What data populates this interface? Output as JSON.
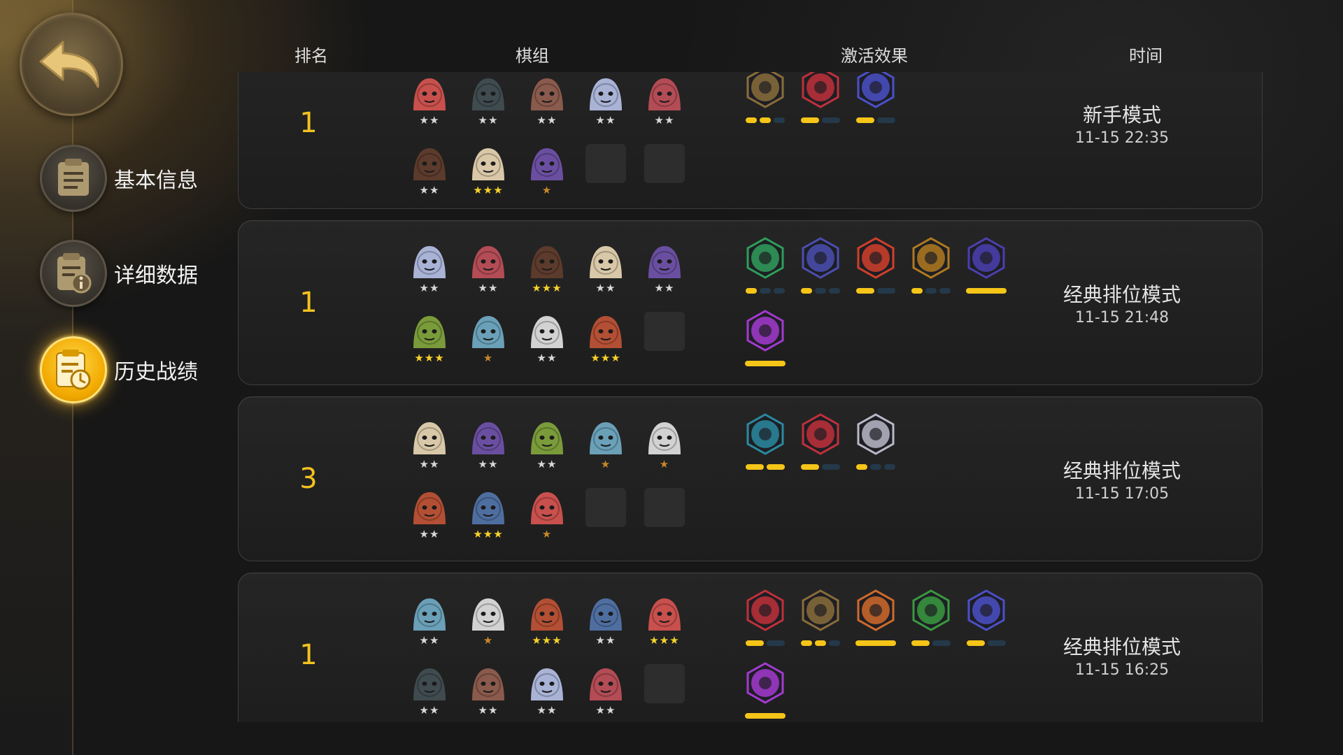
{
  "header": {
    "rank": "排名",
    "lineup": "棋组",
    "effects": "激活效果",
    "time": "时间"
  },
  "sidebar": {
    "back_icon": "back-arrow-icon",
    "items": [
      {
        "label": "基本信息",
        "icon": "notepad-icon",
        "active": false
      },
      {
        "label": "详细数据",
        "icon": "info-document-icon",
        "active": false
      },
      {
        "label": "历史战绩",
        "icon": "history-clock-icon",
        "active": true
      }
    ]
  },
  "colors": {
    "accent_gold": "#f4c21f",
    "active_nav": "#f2a900",
    "bar_on": "#f5c518",
    "bar_off": "#24394a"
  },
  "matches": [
    {
      "rank": "1",
      "mode": "新手模式",
      "time": "11-15 22:35",
      "heroes": [
        {
          "icon": "red-demon-hero",
          "stars": "★★"
        },
        {
          "icon": "green-eye-robot-hero",
          "stars": "★★"
        },
        {
          "icon": "masked-assassin-hero",
          "stars": "★★"
        },
        {
          "icon": "blue-ghost-hero",
          "stars": "★★"
        },
        {
          "icon": "red-hood-hero",
          "stars": "★★"
        },
        {
          "icon": "bearded-warrior-hero",
          "stars": "★★"
        },
        {
          "icon": "white-ogre-hero",
          "stars": "★★★"
        },
        {
          "icon": "purple-skull-hero",
          "stars": "★"
        },
        {
          "icon": "empty-slot",
          "stars": ""
        },
        {
          "icon": "empty-slot",
          "stars": ""
        }
      ],
      "synergies": [
        {
          "icon": "axe-emblem-icon",
          "on": 2,
          "total": 3
        },
        {
          "icon": "red-arch-emblem-icon",
          "on": 1,
          "total": 2
        },
        {
          "icon": "blue-fish-emblem-icon",
          "on": 1,
          "total": 2
        }
      ]
    },
    {
      "rank": "1",
      "mode": "经典排位模式",
      "time": "11-15 21:48",
      "heroes": [
        {
          "icon": "horned-brute-hero",
          "stars": "★★"
        },
        {
          "icon": "green-lizard-hero",
          "stars": "★★"
        },
        {
          "icon": "orc-helmet-hero",
          "stars": "★★★"
        },
        {
          "icon": "green-robot-hero",
          "stars": "★★"
        },
        {
          "icon": "stone-golem-hero",
          "stars": "★★"
        },
        {
          "icon": "green-bandit-hero",
          "stars": "★★★"
        },
        {
          "icon": "feather-chief-hero",
          "stars": "★"
        },
        {
          "icon": "fox-mask-hero",
          "stars": "★★"
        },
        {
          "icon": "goblin-hero",
          "stars": "★★★"
        },
        {
          "icon": "empty-slot",
          "stars": ""
        }
      ],
      "synergies": [
        {
          "icon": "green-paw-emblem-icon",
          "on": 1,
          "total": 3
        },
        {
          "icon": "blue-book-emblem-icon",
          "on": 1,
          "total": 3
        },
        {
          "icon": "red-horn-emblem-icon",
          "on": 1,
          "total": 2
        },
        {
          "icon": "gear-emblem-icon",
          "on": 1,
          "total": 3
        },
        {
          "icon": "wizard-hat-emblem-icon",
          "on": 1,
          "total": 1
        },
        {
          "icon": "purple-demon-emblem-icon",
          "on": 1,
          "total": 1
        }
      ]
    },
    {
      "rank": "3",
      "mode": "经典排位模式",
      "time": "11-15 17:05",
      "heroes": [
        {
          "icon": "green-frog-hero",
          "stars": "★★"
        },
        {
          "icon": "red-hood-hero",
          "stars": "★★"
        },
        {
          "icon": "blue-viking-hero",
          "stars": "★★"
        },
        {
          "icon": "blue-visor-robot-hero",
          "stars": "★"
        },
        {
          "icon": "white-beard-elder-hero",
          "stars": "★"
        },
        {
          "icon": "tribal-girl-hero",
          "stars": "★★"
        },
        {
          "icon": "red-demon-hero",
          "stars": "★★★"
        },
        {
          "icon": "thunder-elder-hero",
          "stars": "★"
        },
        {
          "icon": "empty-slot",
          "stars": ""
        },
        {
          "icon": "empty-slot",
          "stars": ""
        }
      ],
      "synergies": [
        {
          "icon": "blue-question-emblem-icon",
          "on": 2,
          "total": 2
        },
        {
          "icon": "red-arch-emblem-icon",
          "on": 1,
          "total": 2
        },
        {
          "icon": "white-person-emblem-icon",
          "on": 1,
          "total": 3
        }
      ]
    },
    {
      "rank": "1",
      "mode": "经典排位模式",
      "time": "11-15 16:25",
      "heroes": [
        {
          "icon": "masked-assassin-hero",
          "stars": "★★"
        },
        {
          "icon": "bearded-warrior-hero",
          "stars": "★"
        },
        {
          "icon": "goggles-dwarf-hero",
          "stars": "★★★"
        },
        {
          "icon": "white-ogre-hero",
          "stars": "★★"
        },
        {
          "icon": "scarred-brawler-hero",
          "stars": "★★★"
        },
        {
          "icon": "white-mask-hero",
          "stars": "★★"
        },
        {
          "icon": "purple-hood-hero",
          "stars": "★★"
        },
        {
          "icon": "red-demon-hero",
          "stars": "★★"
        },
        {
          "icon": "white-wolf-hero",
          "stars": "★★"
        },
        {
          "icon": "empty-slot",
          "stars": ""
        }
      ],
      "synergies": [
        {
          "icon": "red-arch-emblem-icon",
          "on": 1,
          "total": 2
        },
        {
          "icon": "axe-emblem-icon",
          "on": 2,
          "total": 3
        },
        {
          "icon": "orange-viking-emblem-icon",
          "on": 1,
          "total": 1
        },
        {
          "icon": "green-bow-emblem-icon",
          "on": 1,
          "total": 2
        },
        {
          "icon": "blue-fish-emblem-icon",
          "on": 1,
          "total": 2
        },
        {
          "icon": "purple-demon-emblem-icon",
          "on": 1,
          "total": 1
        }
      ]
    }
  ]
}
